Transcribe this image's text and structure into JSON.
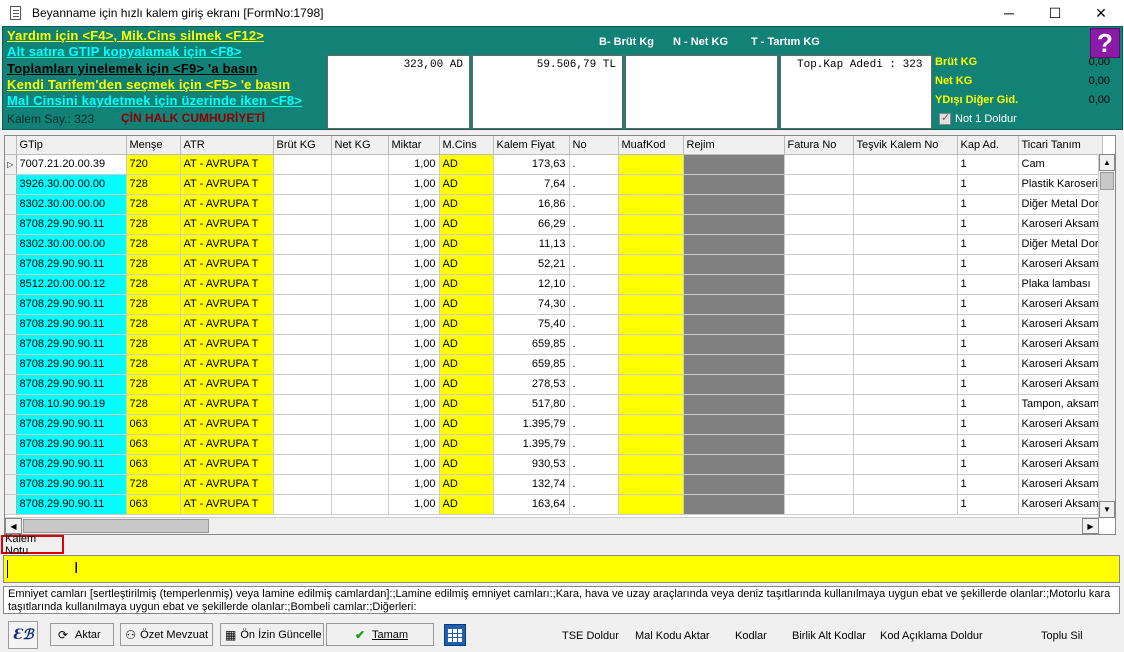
{
  "window": {
    "title": "Beyanname için hızlı kalem giriş ekranı [FormNo:1798]",
    "minimize": "─",
    "maximize": "☐",
    "close": "✕"
  },
  "header": {
    "hints": [
      "Yardım için <F4>, Mik.Cins silmek <F12>",
      "Alt satıra GTIP kopyalamak için <F8>",
      "Toplamları yinelemek için <F9> 'a basın",
      "Kendi Tarifem'den seçmek  için <F5> 'e basın",
      "Mal Cinsini kaydetmek için üzerinde iken <F8>"
    ],
    "kalem_say": "Kalem Say.: 323",
    "country": "ÇİN HALK CUMHURİYETİ",
    "brut": "B- Brüt Kg",
    "net": "N - Net KG",
    "tartim": "T - Tartım KG",
    "box1": "323,00 AD",
    "box2": "59.506,79 TL",
    "box3": "",
    "box4": "Top.Kap Adedi : 323",
    "brut_kg_label": "Brüt KG",
    "brut_kg_value": "0,00",
    "net_kg_label": "Net KG",
    "net_kg_value": "0,00",
    "ydisi_label": "YDışı Diğer Gid.",
    "ydisi_value": "0,00",
    "not1": "Not 1 Doldur",
    "help": "?"
  },
  "grid": {
    "columns": [
      "GTip",
      "Menşe",
      "ATR",
      "Brüt KG",
      "Net KG",
      "Miktar",
      "M.Cins",
      "Kalem Fiyat",
      "No",
      "MuafKod",
      "Rejim",
      "Fatura No",
      "Teşvik Kalem No",
      "Kap Ad.",
      "Ticari Tanım"
    ],
    "rows": [
      {
        "gtip": "7007.21.20.00.39",
        "mense": "720",
        "atr": "AT     - AVRUPA T",
        "miktar": "1,00",
        "mcins": "AD",
        "fiyat": "173,63",
        "no": ".",
        "kap": "1",
        "tanim": "Cam"
      },
      {
        "gtip": "3926.30.00.00.00",
        "mense": "728",
        "atr": "AT     - AVRUPA T",
        "miktar": "1,00",
        "mcins": "AD",
        "fiyat": "7,64",
        "no": ".",
        "kap": "1",
        "tanim": "Plastik Karoseri"
      },
      {
        "gtip": "8302.30.00.00.00",
        "mense": "728",
        "atr": "AT     - AVRUPA T",
        "miktar": "1,00",
        "mcins": "AD",
        "fiyat": "16,86",
        "no": ".",
        "kap": "1",
        "tanim": "Diğer Metal Dor"
      },
      {
        "gtip": "8708.29.90.90.11",
        "mense": "728",
        "atr": "AT     - AVRUPA T",
        "miktar": "1,00",
        "mcins": "AD",
        "fiyat": "66,29",
        "no": ".",
        "kap": "1",
        "tanim": "Karoseri Aksam"
      },
      {
        "gtip": "8302.30.00.00.00",
        "mense": "728",
        "atr": "AT     - AVRUPA T",
        "miktar": "1,00",
        "mcins": "AD",
        "fiyat": "11,13",
        "no": ".",
        "kap": "1",
        "tanim": "Diğer Metal Dor"
      },
      {
        "gtip": "8708.29.90.90.11",
        "mense": "728",
        "atr": "AT     - AVRUPA T",
        "miktar": "1,00",
        "mcins": "AD",
        "fiyat": "52,21",
        "no": ".",
        "kap": "1",
        "tanim": "Karoseri Aksam"
      },
      {
        "gtip": "8512.20.00.00.12",
        "mense": "728",
        "atr": "AT     - AVRUPA T",
        "miktar": "1,00",
        "mcins": "AD",
        "fiyat": "12,10",
        "no": ".",
        "kap": "1",
        "tanim": "Plaka lambası"
      },
      {
        "gtip": "8708.29.90.90.11",
        "mense": "728",
        "atr": "AT     - AVRUPA T",
        "miktar": "1,00",
        "mcins": "AD",
        "fiyat": "74,30",
        "no": ".",
        "kap": "1",
        "tanim": "Karoseri Aksam"
      },
      {
        "gtip": "8708.29.90.90.11",
        "mense": "728",
        "atr": "AT     - AVRUPA T",
        "miktar": "1,00",
        "mcins": "AD",
        "fiyat": "75,40",
        "no": ".",
        "kap": "1",
        "tanim": "Karoseri Aksam"
      },
      {
        "gtip": "8708.29.90.90.11",
        "mense": "728",
        "atr": "AT     - AVRUPA T",
        "miktar": "1,00",
        "mcins": "AD",
        "fiyat": "659,85",
        "no": ".",
        "kap": "1",
        "tanim": "Karoseri Aksam"
      },
      {
        "gtip": "8708.29.90.90.11",
        "mense": "728",
        "atr": "AT     - AVRUPA T",
        "miktar": "1,00",
        "mcins": "AD",
        "fiyat": "659,85",
        "no": ".",
        "kap": "1",
        "tanim": "Karoseri Aksam"
      },
      {
        "gtip": "8708.29.90.90.11",
        "mense": "728",
        "atr": "AT     - AVRUPA T",
        "miktar": "1,00",
        "mcins": "AD",
        "fiyat": "278,53",
        "no": ".",
        "kap": "1",
        "tanim": "Karoseri Aksam"
      },
      {
        "gtip": "8708.10.90.90.19",
        "mense": "728",
        "atr": "AT     - AVRUPA T",
        "miktar": "1,00",
        "mcins": "AD",
        "fiyat": "517,80",
        "no": ".",
        "kap": "1",
        "tanim": "Tampon, aksam"
      },
      {
        "gtip": "8708.29.90.90.11",
        "mense": "063",
        "atr": "AT     - AVRUPA T",
        "miktar": "1,00",
        "mcins": "AD",
        "fiyat": "1.395,79",
        "no": ".",
        "kap": "1",
        "tanim": "Karoseri Aksam"
      },
      {
        "gtip": "8708.29.90.90.11",
        "mense": "063",
        "atr": "AT     - AVRUPA T",
        "miktar": "1,00",
        "mcins": "AD",
        "fiyat": "1.395,79",
        "no": ".",
        "kap": "1",
        "tanim": "Karoseri Aksam"
      },
      {
        "gtip": "8708.29.90.90.11",
        "mense": "063",
        "atr": "AT     - AVRUPA T",
        "miktar": "1,00",
        "mcins": "AD",
        "fiyat": "930,53",
        "no": ".",
        "kap": "1",
        "tanim": "Karoseri Aksam"
      },
      {
        "gtip": "8708.29.90.90.11",
        "mense": "728",
        "atr": "AT     - AVRUPA T",
        "miktar": "1,00",
        "mcins": "AD",
        "fiyat": "132,74",
        "no": ".",
        "kap": "1",
        "tanim": "Karoseri Aksam"
      },
      {
        "gtip": "8708.29.90.90.11",
        "mense": "063",
        "atr": "AT     - AVRUPA T",
        "miktar": "1,00",
        "mcins": "AD",
        "fiyat": "163,64",
        "no": ".",
        "kap": "1",
        "tanim": "Karoseri Aksam"
      }
    ]
  },
  "kalem_notu": {
    "label": "Kalem Notu",
    "value": "",
    "description": "Emniyet camları [sertleştirilmiş (temperlenmiş) veya lamine edilmiş camlardan]:;Lamine edilmiş emniyet camları:;Kara, hava ve uzay araçlarında veya deniz taşıtlarında kullanılmaya uygun ebat ve şekillerde olanlar:;Motorlu kara taşıtlarında kullanılmaya uygun ebat ve şekillerde olanlar:;Bombeli camlar:;Diğerleri:"
  },
  "toolbar": {
    "logo": "Ɛℬ",
    "aktar": "Aktar",
    "ozet": "Özet Mevzuat",
    "onizin": "Ön İzin Güncelle",
    "tamam": "Tamam",
    "tse": "TSE Doldur",
    "malkodu": "Mal Kodu Aktar",
    "kodlar": "Kodlar",
    "birlik": "Birlik Alt Kodlar",
    "kodaciklama": "Kod Açıklama Doldur",
    "toplusil": "Toplu Sil"
  },
  "colors": {
    "header_bg": "#128277",
    "yellow": "#ffff00",
    "cyan": "#00ffff",
    "gray": "#808080",
    "help_bg": "#8a1aa8"
  }
}
